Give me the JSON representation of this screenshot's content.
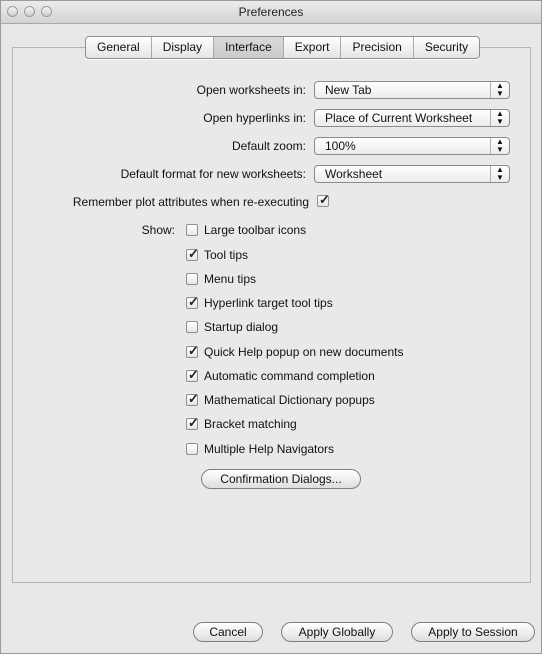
{
  "window": {
    "title": "Preferences"
  },
  "tabs": [
    "General",
    "Display",
    "Interface",
    "Export",
    "Precision",
    "Security"
  ],
  "active_tab": "Interface",
  "settings": {
    "open_worksheets": {
      "label": "Open worksheets in:",
      "value": "New Tab"
    },
    "open_hyperlinks": {
      "label": "Open hyperlinks in:",
      "value": "Place of Current Worksheet"
    },
    "default_zoom": {
      "label": "Default zoom:",
      "value": "100%"
    },
    "default_format": {
      "label": "Default format for new worksheets:",
      "value": "Worksheet"
    },
    "remember_plot": {
      "label": "Remember plot attributes when re-executing",
      "checked": true
    }
  },
  "show": {
    "label": "Show:",
    "items": [
      {
        "label": "Large toolbar icons",
        "checked": false
      },
      {
        "label": "Tool tips",
        "checked": true
      },
      {
        "label": "Menu tips",
        "checked": false
      },
      {
        "label": "Hyperlink target tool tips",
        "checked": true
      },
      {
        "label": "Startup dialog",
        "checked": false
      },
      {
        "label": "Quick Help popup on new documents",
        "checked": true
      },
      {
        "label": "Automatic command completion",
        "checked": true
      },
      {
        "label": "Mathematical Dictionary popups",
        "checked": true
      },
      {
        "label": "Bracket matching",
        "checked": true
      },
      {
        "label": "Multiple Help Navigators",
        "checked": false
      }
    ]
  },
  "buttons": {
    "confirmation": "Confirmation Dialogs...",
    "cancel": "Cancel",
    "apply_globally": "Apply Globally",
    "apply_session": "Apply to Session"
  },
  "icons": {
    "check": "checkmark-icon",
    "select_arrows": "updown-arrows-icon"
  }
}
